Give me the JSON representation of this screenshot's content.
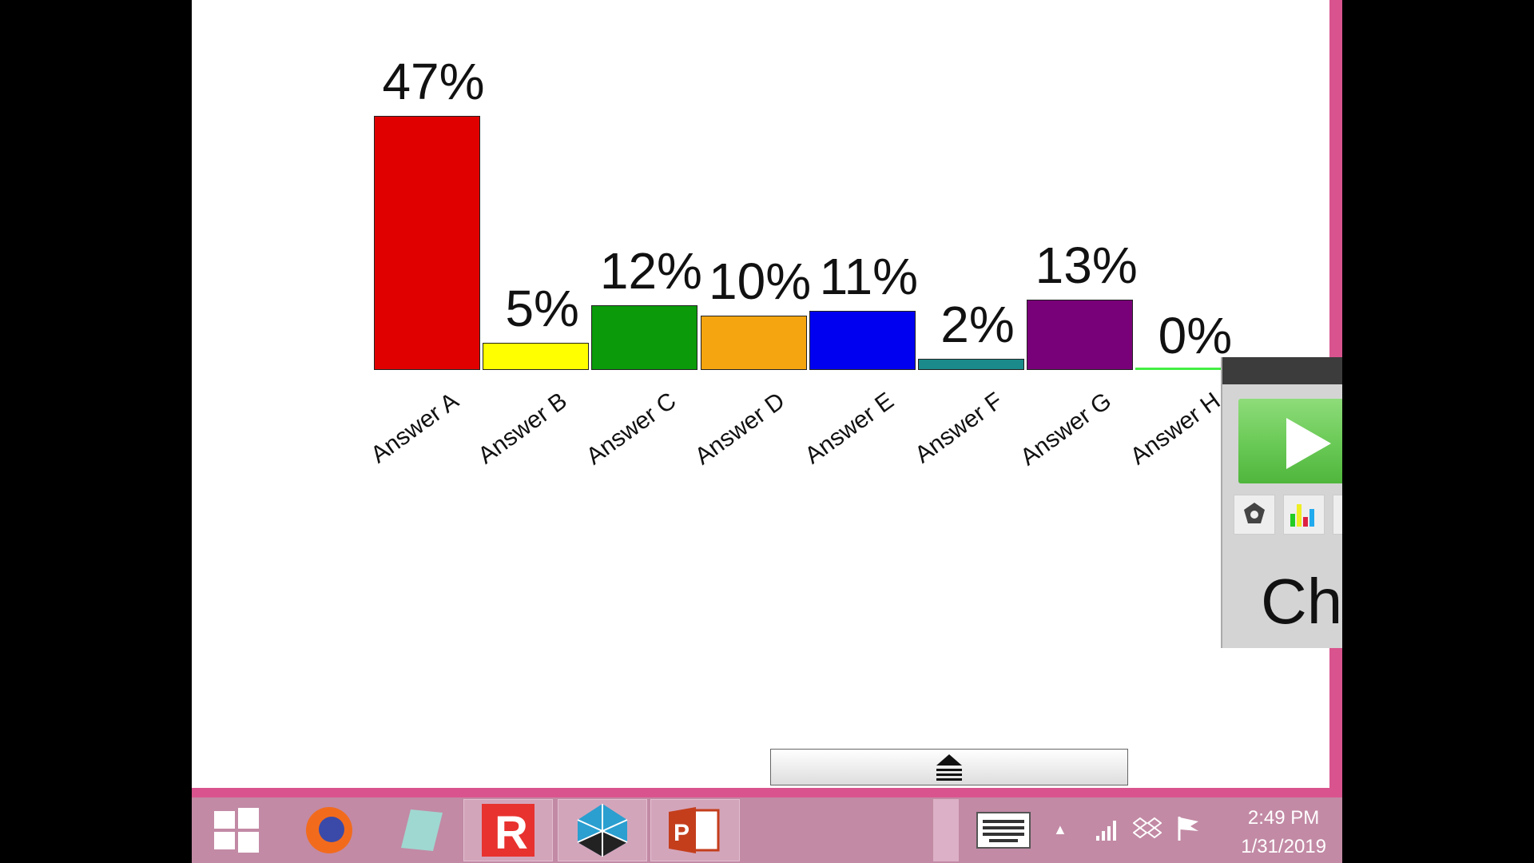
{
  "chart_data": {
    "type": "bar",
    "categories": [
      "Answer A",
      "Answer B",
      "Answer C",
      "Answer D",
      "Answer E",
      "Answer F",
      "Answer G",
      "Answer H"
    ],
    "values": [
      47,
      5,
      12,
      10,
      11,
      2,
      13,
      0
    ],
    "value_labels": [
      "47%",
      "5%",
      "12%",
      "10%",
      "11%",
      "2%",
      "13%",
      "0%"
    ],
    "colors": [
      "#e00000",
      "#ffff00",
      "#0a9a0a",
      "#f5a50f",
      "#0000f0",
      "#1a8a8a",
      "#780078",
      "#44ee44"
    ],
    "title": "",
    "xlabel": "",
    "ylabel": "",
    "ylim": [
      0,
      47
    ],
    "grid": false
  },
  "panel": {
    "title_partial": "Ch"
  },
  "taskbar": {
    "time": "2:49 PM",
    "date": "1/31/2019"
  }
}
